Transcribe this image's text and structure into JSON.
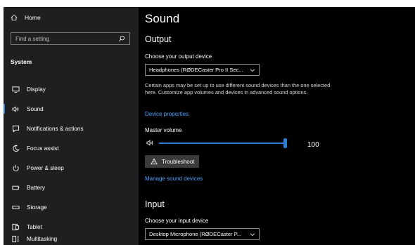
{
  "sidebar": {
    "home_label": "Home",
    "search_placeholder": "Find a setting",
    "section_title": "System",
    "items": [
      {
        "label": "Display",
        "icon": "monitor-icon",
        "active": false
      },
      {
        "label": "Sound",
        "icon": "speaker-icon",
        "active": true
      },
      {
        "label": "Notifications & actions",
        "icon": "notification-icon",
        "active": false
      },
      {
        "label": "Focus assist",
        "icon": "moon-icon",
        "active": false
      },
      {
        "label": "Power & sleep",
        "icon": "power-icon",
        "active": false
      },
      {
        "label": "Battery",
        "icon": "battery-icon",
        "active": false
      },
      {
        "label": "Storage",
        "icon": "storage-icon",
        "active": false
      },
      {
        "label": "Tablet",
        "icon": "tablet-icon",
        "active": false
      },
      {
        "label": "Multitasking",
        "icon": "multitasking-icon",
        "active": false
      }
    ]
  },
  "main": {
    "title": "Sound",
    "output": {
      "heading": "Output",
      "device_label": "Choose your output device",
      "device_value": "Headphones (RØDECaster Pro II Sec...",
      "description": "Certain apps may be set up to use different sound devices than the one selected here. Customize app volumes and devices in advanced sound options.",
      "device_properties_link": "Device properties",
      "master_volume_label": "Master volume",
      "master_volume_value": "100",
      "master_volume_level": 1.0,
      "troubleshoot_label": "Troubleshoot",
      "manage_link": "Manage sound devices"
    },
    "input": {
      "heading": "Input",
      "device_label": "Choose your input device",
      "device_value": "Desktop Microphone (RØDECaster P..."
    }
  },
  "colors": {
    "accent": "#2a7fd4",
    "link": "#4da3ff",
    "sidebar_bg": "#1f1f1f",
    "main_bg": "#000000"
  }
}
